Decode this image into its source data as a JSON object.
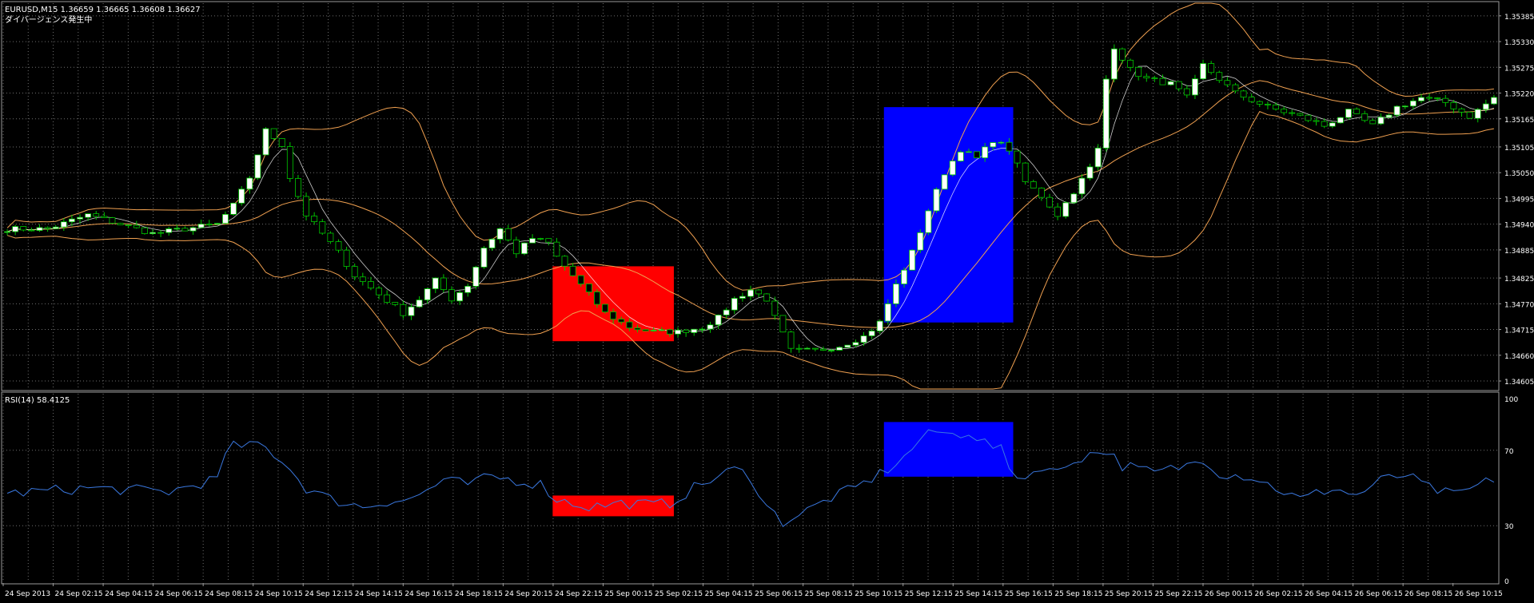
{
  "header": {
    "symbol_line": "EURUSD,M15  1.36659 1.36665 1.36608 1.36627",
    "comment": "ダイバージェンス発生中"
  },
  "rsi_panel": {
    "label": "RSI(14) 58.4125"
  },
  "colors": {
    "background": "#000000",
    "grid": "#6e6e6e",
    "axis_text": "#ffffff",
    "candle_bull": "#ffffff",
    "candle_bear": "#000000",
    "wick": "#00c800",
    "bollinger": "#f0a050",
    "ma_line": "#ffffff",
    "rsi_line": "#3a78e0",
    "box_red": "#ff0000",
    "box_blue": "#0000ff"
  },
  "chart_data": [
    {
      "type": "candlestick",
      "name": "EURUSD,M15",
      "ylim": [
        1.34588,
        1.35412
      ],
      "y_ticks": [
        "1.35385",
        "1.35330",
        "1.35275",
        "1.35220",
        "1.35165",
        "1.35105",
        "1.35050",
        "1.34995",
        "1.34940",
        "1.34885",
        "1.34825",
        "1.34770",
        "1.34715",
        "1.34660",
        "1.34605"
      ],
      "x_labels": [
        "24 Sep 2013",
        "24 Sep 02:15",
        "24 Sep 04:15",
        "24 Sep 06:15",
        "24 Sep 08:15",
        "24 Sep 10:15",
        "24 Sep 12:15",
        "24 Sep 14:15",
        "24 Sep 16:15",
        "24 Sep 18:15",
        "24 Sep 20:15",
        "24 Sep 22:15",
        "25 Sep 00:15",
        "25 Sep 02:15",
        "25 Sep 04:15",
        "25 Sep 06:15",
        "25 Sep 08:15",
        "25 Sep 10:15",
        "25 Sep 12:15",
        "25 Sep 14:15",
        "25 Sep 16:15",
        "25 Sep 18:15",
        "25 Sep 20:15",
        "25 Sep 22:15",
        "26 Sep 00:15",
        "26 Sep 02:15",
        "26 Sep 04:15",
        "26 Sep 06:15",
        "26 Sep 08:15",
        "26 Sep 10:15"
      ],
      "close_keypoints": [
        [
          0,
          1.3493
        ],
        [
          5,
          1.3493
        ],
        [
          10,
          1.3496
        ],
        [
          14,
          1.3494
        ],
        [
          18,
          1.3492
        ],
        [
          22,
          1.3493
        ],
        [
          26,
          1.3494
        ],
        [
          28,
          1.3498
        ],
        [
          30,
          1.3504
        ],
        [
          32,
          1.3514
        ],
        [
          34,
          1.3511
        ],
        [
          35,
          1.3504
        ],
        [
          37,
          1.3496
        ],
        [
          39,
          1.3492
        ],
        [
          41,
          1.3488
        ],
        [
          43,
          1.3483
        ],
        [
          46,
          1.3479
        ],
        [
          49,
          1.3475
        ],
        [
          51,
          1.3478
        ],
        [
          53,
          1.3482
        ],
        [
          55,
          1.3478
        ],
        [
          57,
          1.3481
        ],
        [
          59,
          1.3489
        ],
        [
          61,
          1.3493
        ],
        [
          63,
          1.3488
        ],
        [
          65,
          1.3491
        ],
        [
          67,
          1.349
        ],
        [
          68,
          1.3487
        ],
        [
          70,
          1.3483
        ],
        [
          72,
          1.3479
        ],
        [
          74,
          1.3475
        ],
        [
          77,
          1.3472
        ],
        [
          80,
          1.3471
        ],
        [
          83,
          1.3471
        ],
        [
          86,
          1.3472
        ],
        [
          88,
          1.3474
        ],
        [
          90,
          1.3478
        ],
        [
          92,
          1.348
        ],
        [
          94,
          1.3478
        ],
        [
          95,
          1.3474
        ],
        [
          97,
          1.3467
        ],
        [
          100,
          1.3467
        ],
        [
          103,
          1.3468
        ],
        [
          106,
          1.347
        ],
        [
          108,
          1.3473
        ],
        [
          110,
          1.3481
        ],
        [
          112,
          1.3488
        ],
        [
          114,
          1.3497
        ],
        [
          116,
          1.3505
        ],
        [
          118,
          1.351
        ],
        [
          120,
          1.3508
        ],
        [
          122,
          1.3512
        ],
        [
          124,
          1.351
        ],
        [
          126,
          1.3503
        ],
        [
          128,
          1.35
        ],
        [
          130,
          1.3496
        ],
        [
          132,
          1.3501
        ],
        [
          134,
          1.3506
        ],
        [
          135,
          1.351
        ],
        [
          136,
          1.3525
        ],
        [
          137,
          1.3532
        ],
        [
          139,
          1.3527
        ],
        [
          141,
          1.3525
        ],
        [
          144,
          1.3524
        ],
        [
          146,
          1.3521
        ],
        [
          148,
          1.3528
        ],
        [
          150,
          1.3525
        ],
        [
          152,
          1.3522
        ],
        [
          156,
          1.3519
        ],
        [
          160,
          1.3517
        ],
        [
          163,
          1.3515
        ],
        [
          166,
          1.3518
        ],
        [
          169,
          1.3515
        ],
        [
          172,
          1.3519
        ],
        [
          175,
          1.3521
        ],
        [
          178,
          1.352
        ],
        [
          181,
          1.3517
        ],
        [
          184,
          1.3521
        ]
      ],
      "candles": 185,
      "bollinger_bands": true,
      "highlight_boxes": [
        {
          "color": "red",
          "x_range": [
            68,
            82
          ],
          "price_range": [
            1.3469,
            1.3485
          ]
        },
        {
          "color": "blue",
          "x_range": [
            109,
            124
          ],
          "price_range": [
            1.3473,
            1.3519
          ]
        }
      ]
    },
    {
      "type": "line",
      "name": "RSI(14)",
      "ylim": [
        0,
        100
      ],
      "y_ticks": [
        "100",
        "70",
        "30",
        "0"
      ],
      "levels": [
        70,
        30
      ],
      "series_keypoints": [
        [
          0,
          47
        ],
        [
          10,
          50
        ],
        [
          20,
          48
        ],
        [
          26,
          55
        ],
        [
          28,
          76
        ],
        [
          29,
          70
        ],
        [
          31,
          74
        ],
        [
          34,
          65
        ],
        [
          37,
          50
        ],
        [
          40,
          44
        ],
        [
          44,
          40
        ],
        [
          47,
          43
        ],
        [
          50,
          44
        ],
        [
          54,
          54
        ],
        [
          57,
          52
        ],
        [
          60,
          56
        ],
        [
          63,
          54
        ],
        [
          66,
          52
        ],
        [
          68,
          44
        ],
        [
          72,
          40
        ],
        [
          76,
          42
        ],
        [
          80,
          41
        ],
        [
          82,
          42
        ],
        [
          85,
          50
        ],
        [
          88,
          56
        ],
        [
          90,
          60
        ],
        [
          92,
          56
        ],
        [
          94,
          40
        ],
        [
          96,
          32
        ],
        [
          99,
          38
        ],
        [
          102,
          45
        ],
        [
          105,
          50
        ],
        [
          107,
          55
        ],
        [
          109,
          60
        ],
        [
          111,
          66
        ],
        [
          113,
          76
        ],
        [
          115,
          80
        ],
        [
          117,
          78
        ],
        [
          119,
          80
        ],
        [
          121,
          74
        ],
        [
          123,
          70
        ],
        [
          124,
          60
        ],
        [
          126,
          55
        ],
        [
          128,
          62
        ],
        [
          130,
          58
        ],
        [
          132,
          65
        ],
        [
          134,
          68
        ],
        [
          136,
          70
        ],
        [
          138,
          62
        ],
        [
          142,
          58
        ],
        [
          146,
          62
        ],
        [
          148,
          66
        ],
        [
          150,
          58
        ],
        [
          154,
          56
        ],
        [
          158,
          48
        ],
        [
          160,
          44
        ],
        [
          164,
          50
        ],
        [
          167,
          46
        ],
        [
          170,
          54
        ],
        [
          173,
          57
        ],
        [
          176,
          50
        ],
        [
          179,
          46
        ],
        [
          182,
          51
        ],
        [
          184,
          55
        ]
      ],
      "highlight_boxes": [
        {
          "color": "red",
          "x_range": [
            68,
            82
          ],
          "value_range": [
            35,
            46
          ]
        },
        {
          "color": "blue",
          "x_range": [
            109,
            124
          ],
          "value_range": [
            56,
            85
          ]
        }
      ]
    }
  ]
}
